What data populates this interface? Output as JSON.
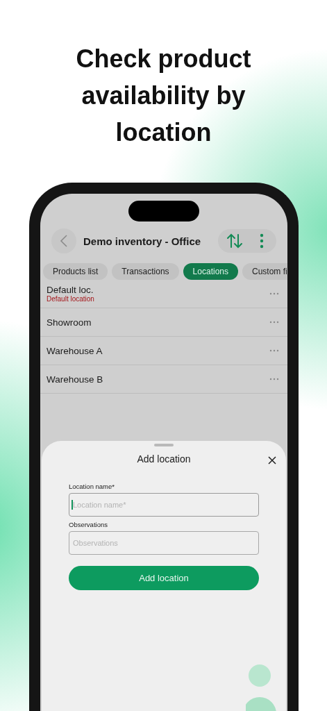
{
  "headline": "Check product availability by location",
  "app_bar": {
    "title": "Demo inventory - Office"
  },
  "tabs": [
    {
      "label": "Products list",
      "selected": false
    },
    {
      "label": "Transactions",
      "selected": false
    },
    {
      "label": "Locations",
      "selected": true
    },
    {
      "label": "Custom fi",
      "selected": false
    }
  ],
  "locations": [
    {
      "name": "Default loc.",
      "note": "Default location"
    },
    {
      "name": "Showroom"
    },
    {
      "name": "Warehouse A"
    },
    {
      "name": "Warehouse B"
    }
  ],
  "sheet": {
    "title": "Add location",
    "fields": [
      {
        "label": "Location name*",
        "placeholder": "Location name*",
        "focused": true
      },
      {
        "label": "Observations",
        "placeholder": "Observations",
        "focused": false
      }
    ],
    "submit": "Add location"
  }
}
